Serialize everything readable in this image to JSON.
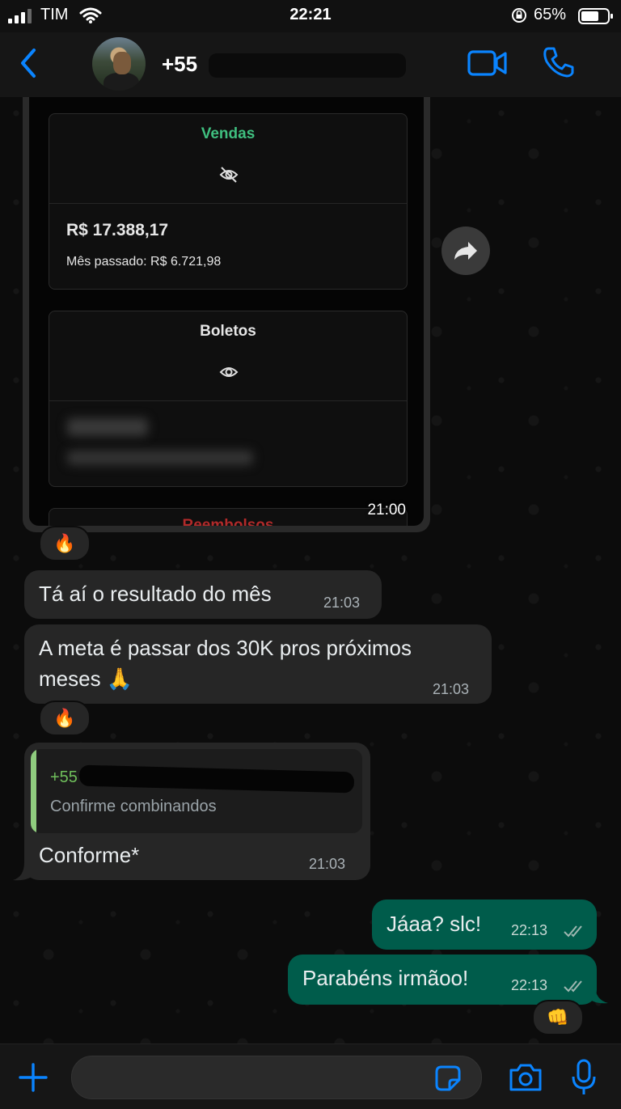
{
  "status_bar": {
    "carrier": "TIM",
    "time": "22:21",
    "battery_percent": "65%"
  },
  "header": {
    "contact_name": "+55"
  },
  "image_message": {
    "cards": [
      {
        "title": "Vendas",
        "title_color": "#3fbf7f",
        "value": "R$ 17.388,17",
        "sub": "Mês passado: R$ 6.721,98"
      },
      {
        "title": "Boletos",
        "title_color": "#e6e6e6"
      }
    ],
    "peek_title": "Reembolsos",
    "time": "21:00"
  },
  "messages": [
    {
      "text": "Tá aí o resultado do mês",
      "time": "21:03",
      "direction": "in"
    },
    {
      "text_line1": "A meta é passar dos 30K pros próximos",
      "text_line2": "meses 🙏",
      "time": "21:03",
      "direction": "in"
    },
    {
      "quote_sender": "+55",
      "quote_text": "Confirme combinandos",
      "text": "Conforme*",
      "time": "21:03",
      "direction": "in"
    },
    {
      "text": "Jáaa? slc!",
      "time": "22:13",
      "direction": "out"
    },
    {
      "text": "Parabéns irmãoo!",
      "time": "22:13",
      "direction": "out"
    }
  ],
  "reactions": [
    "🔥",
    "🔥",
    "👊"
  ],
  "colors": {
    "accent": "#0a84ff",
    "outgoing_bubble": "#005c4b",
    "incoming_bubble": "#262626"
  }
}
